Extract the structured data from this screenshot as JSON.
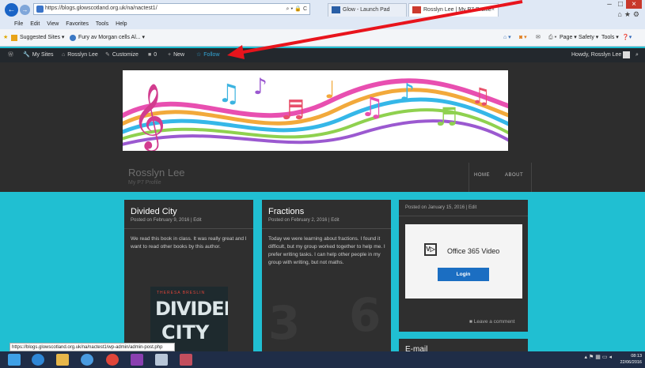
{
  "browser": {
    "url": "https://blogs.glowscotland.org.uk/na/nactest1/",
    "address_icons": "⌕ ▾ 🔒 C",
    "tabs": [
      {
        "label": "Glow - Launch Pad"
      },
      {
        "label": "Rosslyn Lee | My P7 Profile"
      }
    ],
    "menu": [
      "File",
      "Edit",
      "View",
      "Favorites",
      "Tools",
      "Help"
    ],
    "favorites": {
      "suggested": "Suggested Sites ▾",
      "fury": "Fury av Morgan cells Al... ▾"
    },
    "right_tools": {
      "page": "Page ▾",
      "safety": "Safety ▾",
      "tools": "Tools ▾"
    },
    "status_url": "https://blogs.glowscotland.org.uk/na/nactest1/wp-admin/admin-post.php"
  },
  "admin_bar": {
    "my_sites": "My Sites",
    "site_name": "Rosslyn Lee",
    "customize": "Customize",
    "comments_count": "0",
    "new": "New",
    "follow": "Follow",
    "howdy": "Howdy, Rosslyn Lee"
  },
  "site": {
    "title": "Rosslyn Lee",
    "description": "My P7 Profile",
    "nav": [
      "HOME",
      "ABOUT"
    ]
  },
  "posts": [
    {
      "title": "Divided City",
      "meta": "Posted on February 9, 2016  |  Edit",
      "excerpt": "We read this book in class. It was really great and I want to read other books by this author.",
      "book_author": "THERESA BRESLIN",
      "book_title_1": "DIVIDED",
      "book_title_2": "CITY"
    },
    {
      "title": "Fractions",
      "meta": "Posted on February 2, 2016  |  Edit",
      "excerpt": "Today we were learning about fractions. I found it difficult, but my group worked together to help me. I prefer writing tasks. I can help other people in my group with writing, but not maths.",
      "bg_numbers": [
        "3",
        "6"
      ]
    },
    {
      "meta": "Posted on January 15, 2016  |  Edit",
      "video_logo": "V▷",
      "video_title": "Office 365 Video",
      "login": "Login",
      "comment_link": "Leave a comment"
    }
  ],
  "widget_email": "E-mail",
  "taskbar": {
    "time": "08:13",
    "date": "22/06/2016"
  },
  "colors": {
    "page_bg": "#20bfd2",
    "admin_bar": "#23282d",
    "follow": "#33a6d6",
    "arrow": "#e8141c"
  }
}
